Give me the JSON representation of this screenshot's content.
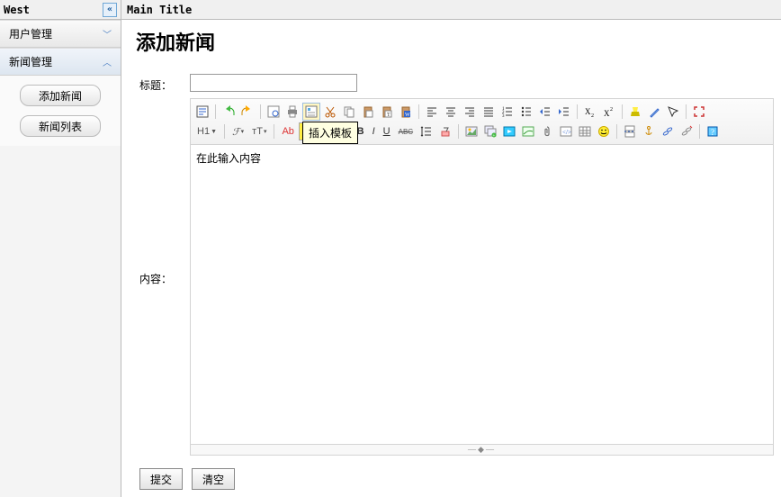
{
  "west": {
    "title": "West",
    "sections": [
      {
        "title": "用户管理",
        "open": false
      },
      {
        "title": "新闻管理",
        "open": true
      }
    ],
    "buttons": [
      "添加新闻",
      "新闻列表"
    ]
  },
  "main": {
    "title": "Main Title"
  },
  "page": {
    "heading": "添加新闻",
    "title_label": "标题：",
    "content_label": "内容：",
    "placeholder_text": "在此输入内容",
    "submit": "提交",
    "clear": "清空",
    "tooltip": "插入模板",
    "h_label": "H1",
    "f_label": "ℱ",
    "t_label": "тT",
    "ab_label": "Ab",
    "tbg_label": "T",
    "b_label": "B",
    "i_label": "I",
    "u_label": "U",
    "abc_label": "ABC"
  }
}
